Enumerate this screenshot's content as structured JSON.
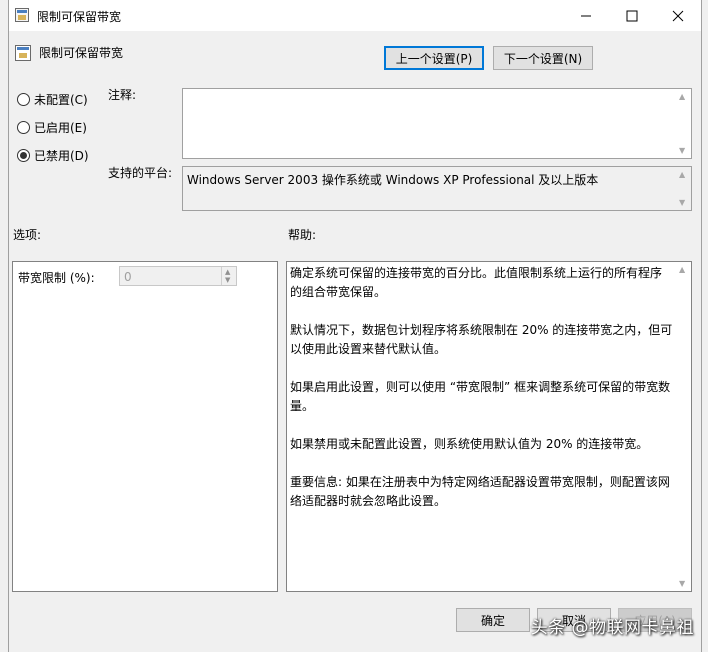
{
  "window": {
    "title": "限制可保留带宽",
    "policy_name": "限制可保留带宽"
  },
  "nav": {
    "prev_setting": "上一个设置(P)",
    "next_setting": "下一个设置(N)"
  },
  "state": {
    "options": [
      {
        "label": "未配置(C)",
        "checked": false
      },
      {
        "label": "已启用(E)",
        "checked": false
      },
      {
        "label": "已禁用(D)",
        "checked": true
      }
    ]
  },
  "comment": {
    "label": "注释:",
    "value": ""
  },
  "platform": {
    "label": "支持的平台:",
    "value": "Windows Server 2003 操作系统或 Windows XP Professional 及以上版本"
  },
  "options_section": {
    "heading": "选项:",
    "bandwidth_label": "带宽限制 (%):",
    "bandwidth_value": "0"
  },
  "help_section": {
    "heading": "帮助:",
    "text": "确定系统可保留的连接带宽的百分比。此值限制系统上运行的所有程序的组合带宽保留。\n\n默认情况下，数据包计划程序将系统限制在 20% 的连接带宽之内，但可以使用此设置来替代默认值。\n\n如果启用此设置，则可以使用 “带宽限制” 框来调整系统可保留的带宽数量。\n\n如果禁用或未配置此设置，则系统使用默认值为 20% 的连接带宽。\n\n重要信息: 如果在注册表中为特定网络适配器设置带宽限制，则配置该网络适配器时就会忽略此设置。"
  },
  "footer": {
    "ok": "确定",
    "cancel": "取消",
    "apply": "应用(A)"
  },
  "watermark": "头条 @物联网卡鼻祖"
}
